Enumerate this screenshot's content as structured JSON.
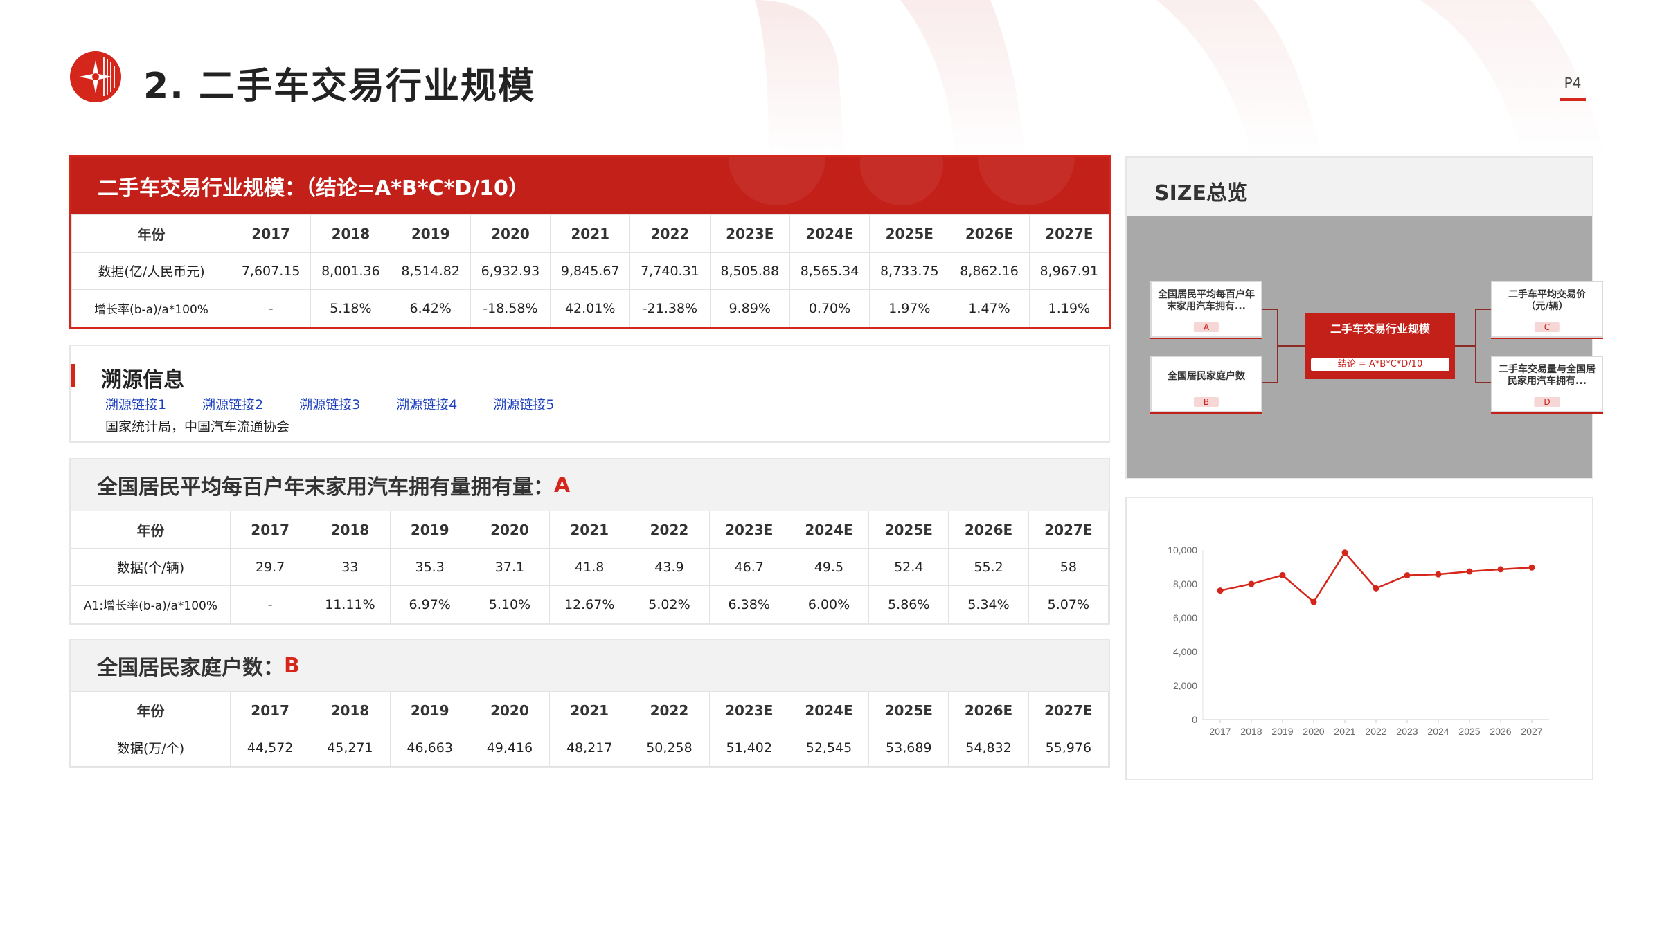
{
  "header": {
    "title": "2.  二手车交易行业规模",
    "page_no": "P4",
    "brand_color": "#d5261b"
  },
  "main_table": {
    "title": "二手车交易行业规模：（结论=A*B*C*D/10）",
    "columns": [
      "年份",
      "2017",
      "2018",
      "2019",
      "2020",
      "2021",
      "2022",
      "2023E",
      "2024E",
      "2025E",
      "2026E",
      "2027E"
    ],
    "rows": [
      [
        "数据(亿/人民币元)",
        "7,607.15",
        "8,001.36",
        "8,514.82",
        "6,932.93",
        "9,845.67",
        "7,740.31",
        "8,505.88",
        "8,565.34",
        "8,733.75",
        "8,862.16",
        "8,967.91"
      ],
      [
        "增长率(b-a)/a*100%",
        "-",
        "5.18%",
        "6.42%",
        "-18.58%",
        "42.01%",
        "-21.38%",
        "9.89%",
        "0.70%",
        "1.97%",
        "1.47%",
        "1.19%"
      ]
    ]
  },
  "source": {
    "title": "溯源信息",
    "links": [
      "溯源链接1",
      "溯源链接2",
      "溯源链接3",
      "溯源链接4",
      "溯源链接5"
    ],
    "org": "国家统计局，中国汽车流通协会"
  },
  "table_a": {
    "title": "全国居民平均每百户年末家用汽车拥有量拥有量：",
    "letter": "A",
    "columns": [
      "年份",
      "2017",
      "2018",
      "2019",
      "2020",
      "2021",
      "2022",
      "2023E",
      "2024E",
      "2025E",
      "2026E",
      "2027E"
    ],
    "rows": [
      [
        "数据(个/辆)",
        "29.7",
        "33",
        "35.3",
        "37.1",
        "41.8",
        "43.9",
        "46.7",
        "49.5",
        "52.4",
        "55.2",
        "58"
      ],
      [
        "A1:增长率(b-a)/a*100%",
        "-",
        "11.11%",
        "6.97%",
        "5.10%",
        "12.67%",
        "5.02%",
        "6.38%",
        "6.00%",
        "5.86%",
        "5.34%",
        "5.07%"
      ]
    ]
  },
  "table_b": {
    "title": "全国居民家庭户数：",
    "letter": "B",
    "columns": [
      "年份",
      "2017",
      "2018",
      "2019",
      "2020",
      "2021",
      "2022",
      "2023E",
      "2024E",
      "2025E",
      "2026E",
      "2027E"
    ],
    "rows": [
      [
        "数据(万/个)",
        "44,572",
        "45,271",
        "46,663",
        "49,416",
        "48,217",
        "50,258",
        "51,402",
        "52,545",
        "53,689",
        "54,832",
        "55,976"
      ]
    ]
  },
  "size_overview": {
    "title": "SIZE总览",
    "center": {
      "label": "二手车交易行业规模",
      "formula": "结论 = A*B*C*D/10"
    },
    "nodes": [
      {
        "label": "全国居民平均每百户年末家用汽车拥有...",
        "letter": "A"
      },
      {
        "label": "全国居民家庭户数",
        "letter": "B"
      },
      {
        "label": "二手车平均交易价（元/辆）",
        "letter": "C"
      },
      {
        "label": "二手车交易量与全国居民家用汽车拥有...",
        "letter": "D"
      }
    ]
  },
  "chart_data": {
    "type": "line",
    "x": [
      "2017",
      "2018",
      "2019",
      "2020",
      "2021",
      "2022",
      "2023",
      "2024",
      "2025",
      "2026",
      "2027"
    ],
    "values": [
      7607.15,
      8001.36,
      8514.82,
      6932.93,
      9845.67,
      7740.31,
      8505.88,
      8565.34,
      8733.75,
      8862.16,
      8967.91
    ],
    "yticks": [
      "0",
      "2,000",
      "4,000",
      "6,000",
      "8,000",
      "10,000"
    ],
    "ylim": [
      0,
      10000
    ],
    "grid": false,
    "color": "#d5261b"
  }
}
